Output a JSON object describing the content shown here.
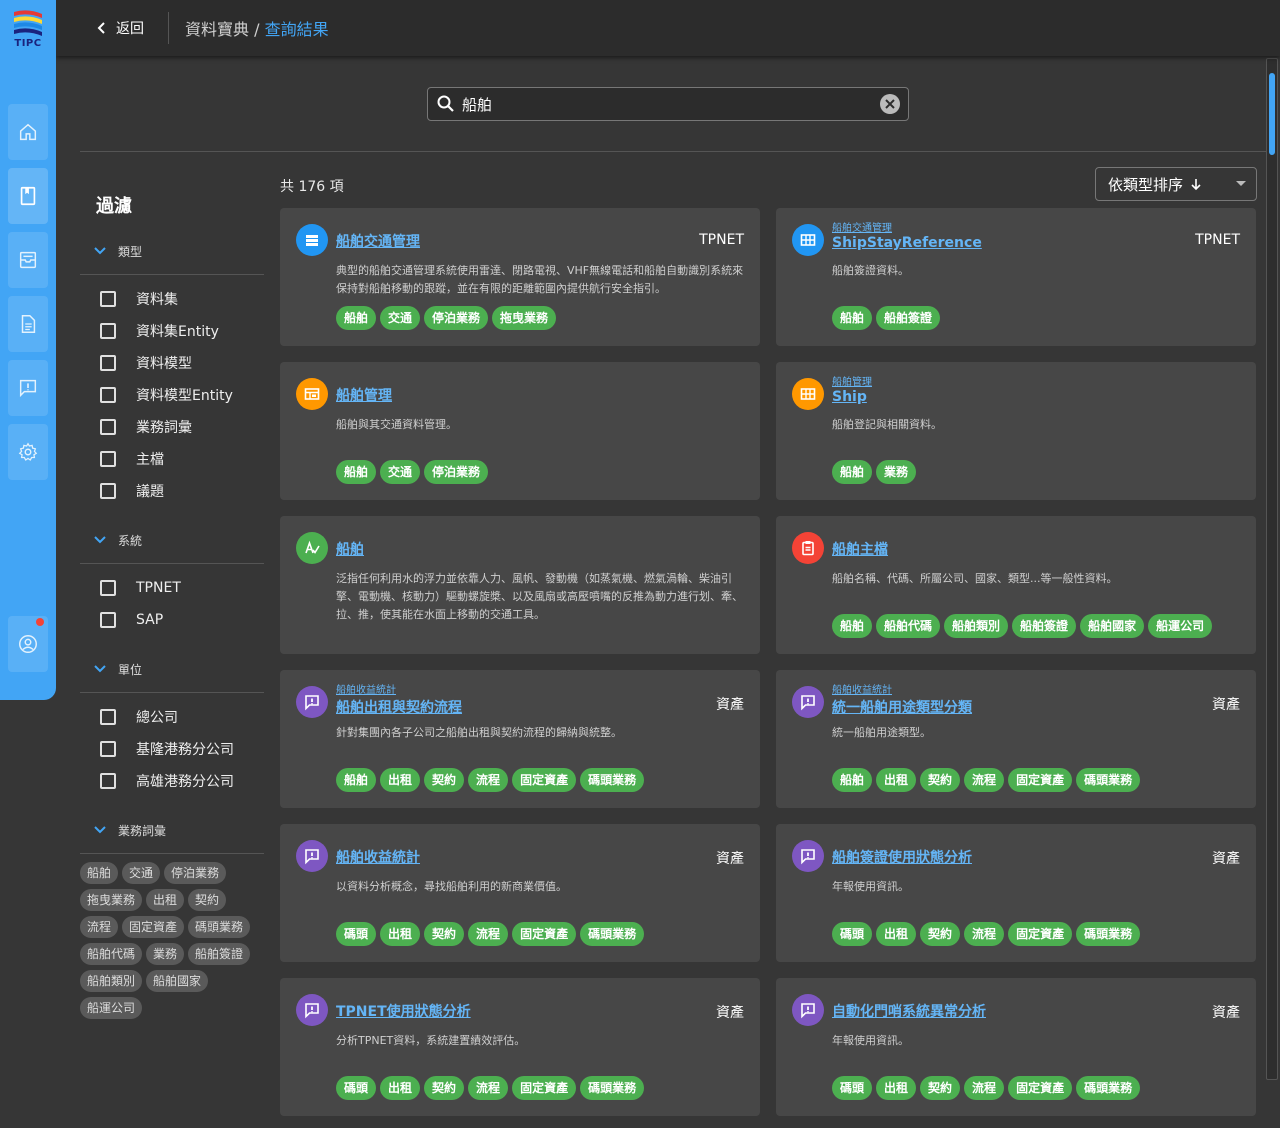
{
  "app": {
    "logo_text": "TIPC"
  },
  "header": {
    "back_label": "返回",
    "breadcrumb_root": "資料寶典 /",
    "breadcrumb_current": "查詢結果"
  },
  "search": {
    "value": "船舶"
  },
  "filter": {
    "title": "過濾",
    "sections": [
      {
        "label": "類型",
        "options": [
          "資料集",
          "資料集Entity",
          "資料模型",
          "資料模型Entity",
          "業務詞彙",
          "主檔",
          "議題"
        ]
      },
      {
        "label": "系統",
        "options": [
          "TPNET",
          "SAP"
        ]
      },
      {
        "label": "單位",
        "options": [
          "總公司",
          "基隆港務分公司",
          "高雄港務分公司"
        ]
      },
      {
        "label": "業務詞彙",
        "chips": [
          "船舶",
          "交通",
          "停泊業務",
          "拖曳業務",
          "出租",
          "契約",
          "流程",
          "固定資產",
          "碼頭業務",
          "船舶代碼",
          "業務",
          "船舶簽證",
          "船舶類別",
          "船舶國家",
          "船運公司"
        ]
      }
    ]
  },
  "results": {
    "count_label": "共 176 項",
    "sort_label": "依類型排序",
    "cards": [
      {
        "icon": "list-icon",
        "color": "#2196f3",
        "parent": "",
        "title": "船舶交通管理",
        "system": "TPNET",
        "desc": "典型的船舶交通管理系統使用雷達、閉路電視、VHF無線電話和船舶自動識別系統來保持對船舶移動的跟蹤，並在有限的距離範圍內提供航行安全指引。",
        "tags": [
          "船舶",
          "交通",
          "停泊業務",
          "拖曳業務"
        ]
      },
      {
        "icon": "table-icon",
        "color": "#2196f3",
        "parent": "船舶交通管理",
        "title": "ShipStayReference",
        "system": "TPNET",
        "desc": "船舶簽證資料。",
        "tags": [
          "船舶",
          "船舶簽證"
        ]
      },
      {
        "icon": "model-icon",
        "color": "#ff9800",
        "parent": "",
        "title": "船舶管理",
        "system": "",
        "desc": "船舶與其交通資料管理。",
        "tags": [
          "船舶",
          "交通",
          "停泊業務"
        ]
      },
      {
        "icon": "table-icon",
        "color": "#ff9800",
        "parent": "船舶管理",
        "title": "Ship",
        "system": "",
        "desc": "船舶登記與相關資料。",
        "tags": [
          "船舶",
          "業務"
        ]
      },
      {
        "icon": "glossary-icon",
        "color": "#4caf50",
        "parent": "",
        "title": "船舶",
        "system": "",
        "desc": "泛指任何利用水的浮力並依靠人力、風帆、發動機（如蒸氣機、燃氣渦輪、柴油引擎、電動機、核動力）驅動螺旋槳、以及風扇或高壓噴嘴的反推為動力進行划、牽、拉、推，使其能在水面上移動的交通工具。",
        "tags": []
      },
      {
        "icon": "clipboard-icon",
        "color": "#f44336",
        "parent": "",
        "title": "船舶主檔",
        "system": "",
        "desc": "船舶名稱、代碼、所屬公司、國家、類型...等一般性資料。",
        "tags": [
          "船舶",
          "船舶代碼",
          "船舶類別",
          "船舶簽證",
          "船舶國家",
          "船運公司"
        ]
      },
      {
        "icon": "issue-icon",
        "color": "#7e57c2",
        "parent": "船舶收益統計",
        "title": "船舶出租與契約流程",
        "system": "資產",
        "desc": "針對集團內各子公司之船舶出租與契約流程的歸納與統整。",
        "tags": [
          "船舶",
          "出租",
          "契約",
          "流程",
          "固定資產",
          "碼頭業務"
        ]
      },
      {
        "icon": "issue-icon",
        "color": "#7e57c2",
        "parent": "船舶收益統計",
        "title": "統一船舶用途類型分類",
        "system": "資產",
        "desc": "統一船舶用途類型。",
        "tags": [
          "船舶",
          "出租",
          "契約",
          "流程",
          "固定資產",
          "碼頭業務"
        ]
      },
      {
        "icon": "issue-icon",
        "color": "#7e57c2",
        "parent": "",
        "title": "船舶收益統計",
        "system": "資產",
        "desc": "以資料分析概念，尋找船舶利用的新商業價值。",
        "tags": [
          "碼頭",
          "出租",
          "契約",
          "流程",
          "固定資產",
          "碼頭業務"
        ]
      },
      {
        "icon": "issue-icon",
        "color": "#7e57c2",
        "parent": "",
        "title": "船舶簽證使用狀態分析",
        "system": "資產",
        "desc": "年報使用資訊。",
        "tags": [
          "碼頭",
          "出租",
          "契約",
          "流程",
          "固定資產",
          "碼頭業務"
        ]
      },
      {
        "icon": "issue-icon",
        "color": "#7e57c2",
        "parent": "",
        "title": "TPNET使用狀態分析",
        "system": "資產",
        "desc": "分析TPNET資料，系統建置績效評估。",
        "tags": [
          "碼頭",
          "出租",
          "契約",
          "流程",
          "固定資產",
          "碼頭業務"
        ]
      },
      {
        "icon": "issue-icon",
        "color": "#7e57c2",
        "parent": "",
        "title": "自動化門哨系統異常分析",
        "system": "資產",
        "desc": "年報使用資訊。",
        "tags": [
          "碼頭",
          "出租",
          "契約",
          "流程",
          "固定資產",
          "碼頭業務"
        ]
      }
    ]
  }
}
